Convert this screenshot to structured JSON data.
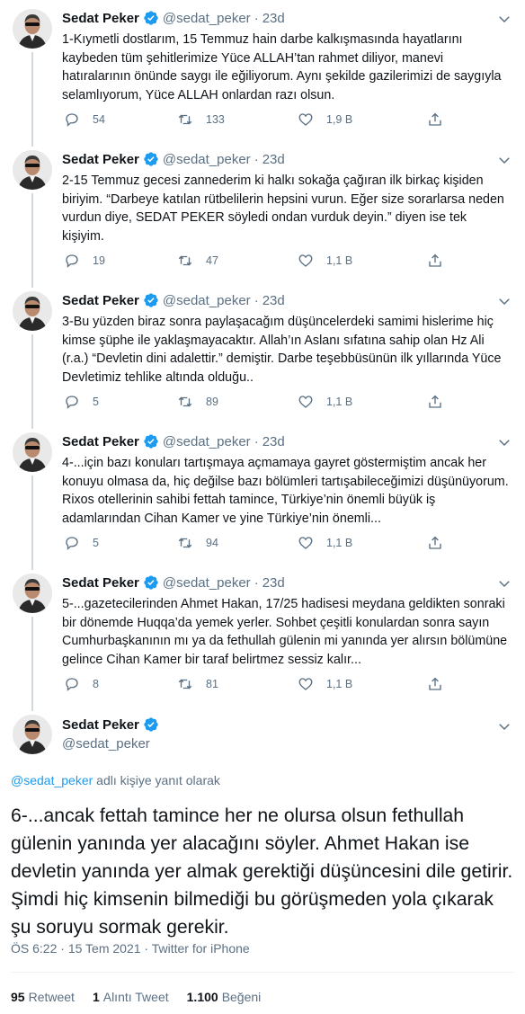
{
  "author": {
    "name": "Sedat Peker",
    "handle": "@sedat_peker"
  },
  "colors": {
    "verified": "#1d9bf0",
    "muted": "#5b7083",
    "link": "#1d9bf0",
    "text": "#0f1419"
  },
  "thread": [
    {
      "age": "23d",
      "text": "1-Kıymetli dostlarım, 15 Temmuz hain darbe kalkışmasında hayatlarını kaybeden tüm şehitlerimize Yüce ALLAH’tan rahmet diliyor, manevi hatıralarının önünde saygı ile eğiliyorum. Aynı şekilde gazilerimizi de saygıyla selamlıyorum, Yüce ALLAH onlardan razı olsun.",
      "replies": "54",
      "retweets": "133",
      "likes": "1,9 B"
    },
    {
      "age": "23d",
      "text": "2-15 Temmuz gecesi zannederim ki halkı sokağa çağıran ilk birkaç kişiden biriyim. “Darbeye katılan rütbelilerin hepsini vurun. Eğer size sorarlarsa neden vurdun diye, SEDAT PEKER söyledi ondan vurduk deyin.” diyen ise tek kişiyim.",
      "replies": "19",
      "retweets": "47",
      "likes": "1,1 B"
    },
    {
      "age": "23d",
      "text": "3-Bu yüzden biraz sonra paylaşacağım düşüncelerdeki samimi hislerime hiç kimse şüphe ile yaklaşmayacaktır. Allah’ın Aslanı sıfatına sahip olan Hz Ali (r.a.) “Devletin dini adalettir.” demiştir. Darbe teşebbüsünün ilk yıllarında Yüce Devletimiz tehlike altında olduğu..",
      "replies": "5",
      "retweets": "89",
      "likes": "1,1 B"
    },
    {
      "age": "23d",
      "text": "4-...için bazı konuları tartışmaya açmamaya gayret göstermiştim ancak her konuyu olmasa da, hiç değilse bazı bölümleri tartışabileceğimizi düşünüyorum. Rixos otellerinin sahibi fettah tamince, Türkiye’nin önemli büyük iş adamlarından Cihan Kamer ve yine Türkiye’nin önemli...",
      "replies": "5",
      "retweets": "94",
      "likes": "1,1 B"
    },
    {
      "age": "23d",
      "text": "5-...gazetecilerinden Ahmet Hakan, 17/25 hadisesi meydana geldikten sonraki bir dönemde Huqqa’da yemek yerler. Sohbet çeşitli konulardan sonra sayın Cumhurbaşkanının mı ya da fethullah gülenin mi yanında yer alırsın bölümüne gelince Cihan Kamer bir taraf belirtmez sessiz kalır...",
      "replies": "8",
      "retweets": "81",
      "likes": "1,1 B"
    }
  ],
  "main": {
    "reply_mention": "@sedat_peker",
    "reply_suffix": " adlı kişiye yanıt olarak",
    "text": "6-...ancak fettah tamince her ne olursa olsun fethullah gülenin yanında yer alacağını söyler. Ahmet Hakan ise devletin yanında yer almak gerektiği düşüncesini dile getirir. Şimdi hiç kimsenin bilmediği bu görüşmeden yola çıkarak şu soruyu sormak gerekir.",
    "time": "ÖS 6:22",
    "date": "15 Tem 2021",
    "source": "Twitter for iPhone",
    "separator": "·",
    "stats": {
      "retweets_count": "95",
      "retweets_label": "Retweet",
      "quotes_count": "1",
      "quotes_label": "Alıntı Tweet",
      "likes_count": "1.100",
      "likes_label": "Beğeni"
    }
  },
  "icons": {
    "reply": "reply-icon",
    "retweet": "retweet-icon",
    "like": "heart-icon",
    "share": "share-icon",
    "more": "chevron-down-icon",
    "verified": "verified-badge-icon"
  }
}
